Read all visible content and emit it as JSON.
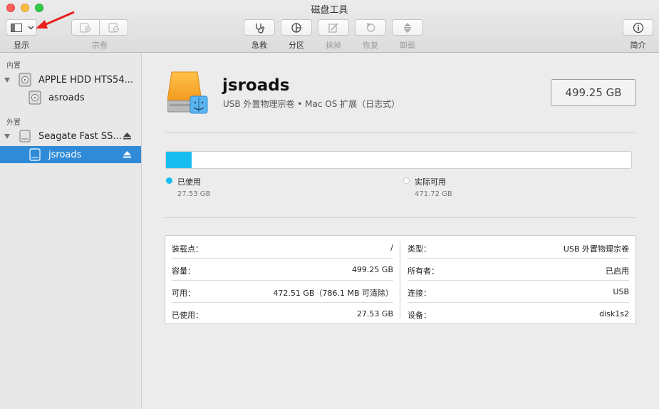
{
  "window": {
    "title": "磁盘工具"
  },
  "toolbar": {
    "view_label": "显示",
    "volume_label": "宗卷",
    "first_aid_label": "急救",
    "partition_label": "分区",
    "erase_label": "抹掉",
    "restore_label": "恢复",
    "unmount_label": "卸载",
    "info_label": "简介"
  },
  "sidebar": {
    "internal_header": "内置",
    "external_header": "外置",
    "items": [
      {
        "label": "APPLE HDD HTS54...",
        "icon": "internal-disk-icon"
      },
      {
        "label": "asroads",
        "icon": "internal-volume-icon"
      },
      {
        "label": "Seagate Fast SS...",
        "icon": "external-disk-icon"
      },
      {
        "label": "jsroads",
        "icon": "external-volume-icon"
      }
    ]
  },
  "volume": {
    "name": "jsroads",
    "description": "USB 外置物理宗卷 • Mac OS 扩展（日志式）",
    "capacity": "499.25 GB"
  },
  "usage": {
    "used_fraction": 0.0551,
    "used_label": "已使用",
    "used_value": "27.53 GB",
    "free_label": "实际可用",
    "free_value": "471.72 GB",
    "used_color": "#18bdf0"
  },
  "info": {
    "left": [
      {
        "key": "装载点：",
        "value": "/"
      },
      {
        "key": "容量：",
        "value": "499.25 GB"
      },
      {
        "key": "可用：",
        "value": "472.51 GB（786.1 MB 可清除）"
      },
      {
        "key": "已使用：",
        "value": "27.53 GB"
      }
    ],
    "right": [
      {
        "key": "类型：",
        "value": "USB 外置物理宗卷"
      },
      {
        "key": "所有者：",
        "value": "已启用"
      },
      {
        "key": "连接：",
        "value": "USB"
      },
      {
        "key": "设备：",
        "value": "disk1s2"
      }
    ]
  }
}
